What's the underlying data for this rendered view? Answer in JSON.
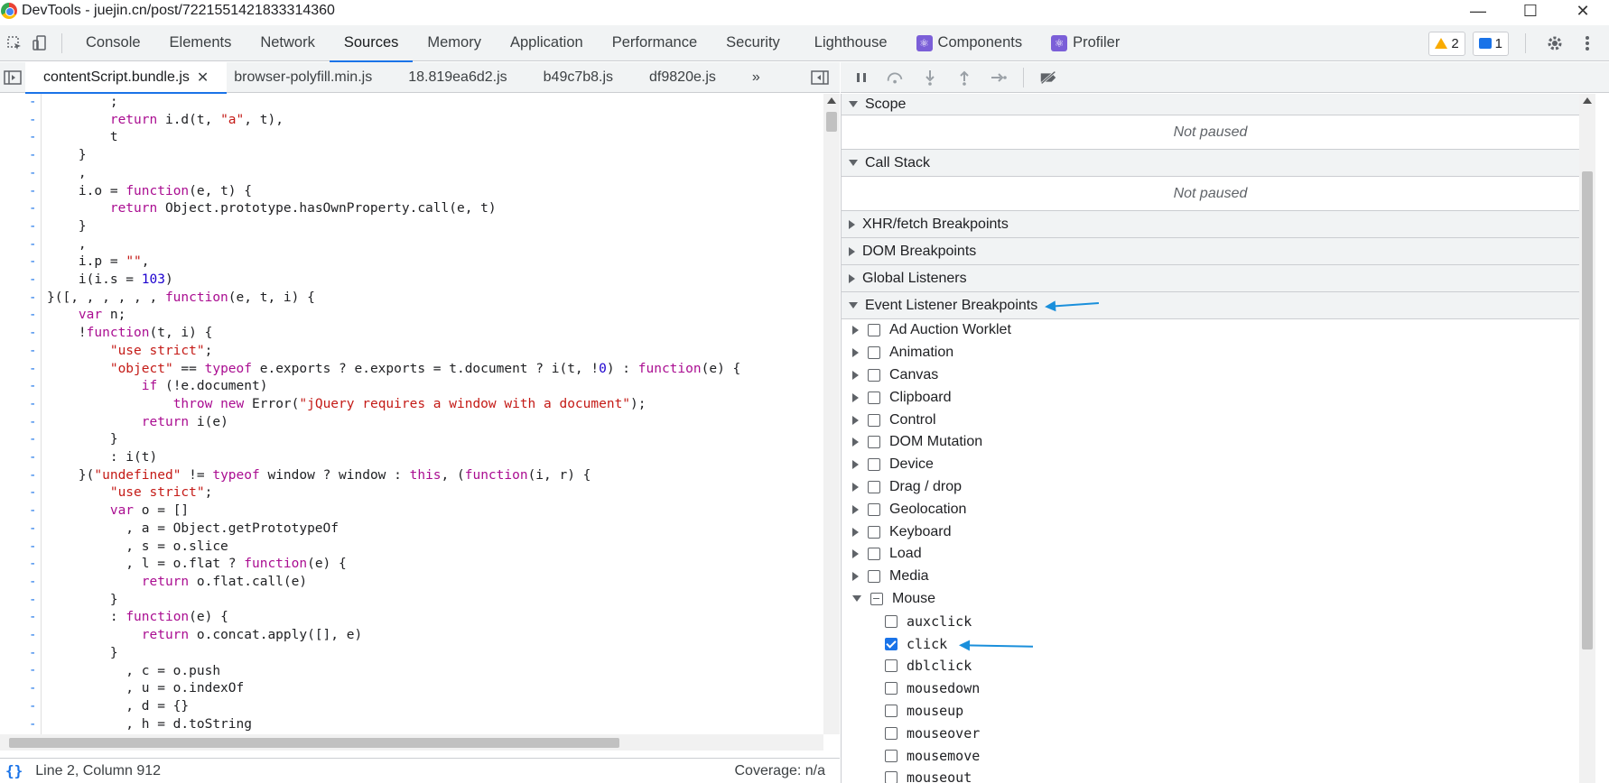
{
  "window": {
    "title": "DevTools - juejin.cn/post/7221551421833314360",
    "controls": [
      "—",
      "☐",
      "✕"
    ]
  },
  "main_tabs": [
    {
      "label": "Console"
    },
    {
      "label": "Elements"
    },
    {
      "label": "Network"
    },
    {
      "label": "Sources",
      "active": true
    },
    {
      "label": "Memory"
    },
    {
      "label": "Application"
    },
    {
      "label": "Performance"
    },
    {
      "label": "Security"
    },
    {
      "label": "Lighthouse"
    },
    {
      "label": "Components"
    },
    {
      "label": "Profiler"
    }
  ],
  "counters": {
    "warnings": "2",
    "messages": "1"
  },
  "source_tabs": [
    {
      "label": "contentScript.bundle.js",
      "active": true
    },
    {
      "label": "browser-polyfill.min.js"
    },
    {
      "label": "18.819ea6d2.js"
    },
    {
      "label": "b49c7b8.js"
    },
    {
      "label": "df9820e.js"
    },
    {
      "label": "»"
    }
  ],
  "status": {
    "position": "Line 2, Column 912",
    "coverage": "Coverage: n/a"
  },
  "sections": {
    "scope": "Scope",
    "call_stack": "Call Stack",
    "not_paused": "Not paused",
    "xhr": "XHR/fetch Breakpoints",
    "dom": "DOM Breakpoints",
    "global": "Global Listeners",
    "event": "Event Listener Breakpoints"
  },
  "categories": [
    "Ad Auction Worklet",
    "Animation",
    "Canvas",
    "Clipboard",
    "Control",
    "DOM Mutation",
    "Device",
    "Drag / drop",
    "Geolocation",
    "Keyboard",
    "Load",
    "Media",
    "Mouse"
  ],
  "mouse_events": [
    {
      "label": "auxclick",
      "checked": false
    },
    {
      "label": "click",
      "checked": true
    },
    {
      "label": "dblclick",
      "checked": false
    },
    {
      "label": "mousedown",
      "checked": false
    },
    {
      "label": "mouseup",
      "checked": false
    },
    {
      "label": "mouseover",
      "checked": false
    },
    {
      "label": "mousemove",
      "checked": false
    },
    {
      "label": "mouseout",
      "checked": false
    }
  ],
  "code_lines": [
    "        ;",
    "        return i.d(t, \"a\", t),",
    "        t",
    "    }",
    "    ,",
    "    i.o = function(e, t) {",
    "        return Object.prototype.hasOwnProperty.call(e, t)",
    "    }",
    "    ,",
    "    i.p = \"\",",
    "    i(i.s = 103)",
    "}([, , , , , , function(e, t, i) {",
    "    var n;",
    "    !function(t, i) {",
    "        \"use strict\";",
    "        \"object\" == typeof e.exports ? e.exports = t.document ? i(t, !0) : function(e) {",
    "            if (!e.document)",
    "                throw new Error(\"jQuery requires a window with a document\");",
    "            return i(e)",
    "        }",
    "        : i(t)",
    "    }(\"undefined\" != typeof window ? window : this, (function(i, r) {",
    "        \"use strict\";",
    "        var o = []",
    "          , a = Object.getPrototypeOf",
    "          , s = o.slice",
    "          , l = o.flat ? function(e) {",
    "            return o.flat.call(e)",
    "        }",
    "        : function(e) {",
    "            return o.concat.apply([], e)",
    "        }",
    "          , c = o.push",
    "          , u = o.indexOf",
    "          , d = {}",
    "          , h = d.toString"
  ]
}
